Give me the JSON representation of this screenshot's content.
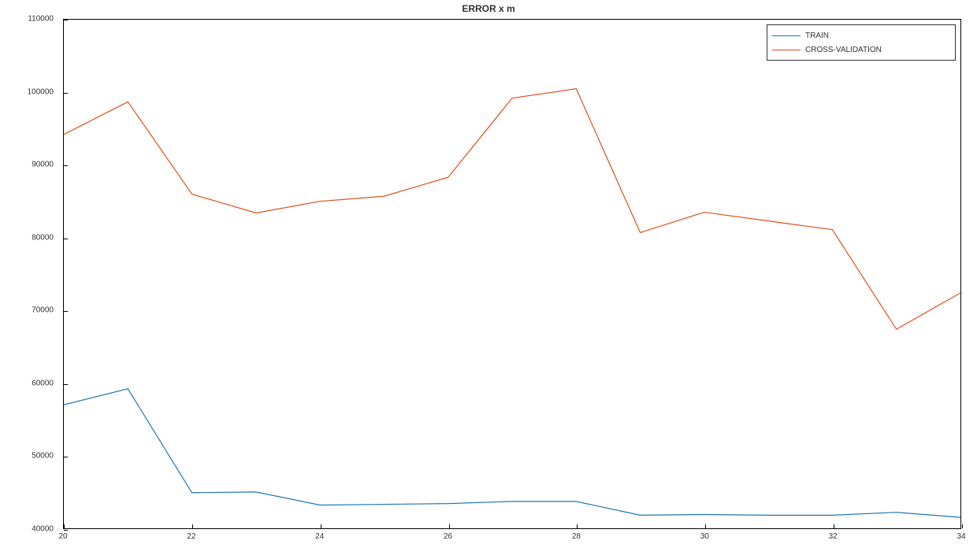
{
  "chart_data": {
    "type": "line",
    "title": "ERROR x m",
    "xlabel": "",
    "ylabel": "",
    "xlim": [
      20,
      34
    ],
    "ylim": [
      40000,
      110000
    ],
    "x_ticks": [
      20,
      22,
      24,
      26,
      28,
      30,
      32,
      34
    ],
    "y_ticks": [
      40000,
      50000,
      60000,
      70000,
      80000,
      90000,
      100000,
      110000
    ],
    "grid": false,
    "legend_position": "top-right",
    "x": [
      20,
      21,
      22,
      23,
      24,
      25,
      26,
      27,
      28,
      29,
      30,
      31,
      32,
      33,
      34
    ],
    "series": [
      {
        "name": "TRAIN",
        "color": "#1f77b4",
        "values": [
          57000,
          59200,
          44900,
          45000,
          43200,
          43300,
          43400,
          43700,
          43700,
          41800,
          41900,
          41800,
          41800,
          42200,
          41500
        ]
      },
      {
        "name": "CROSS-VALIDATION",
        "color": "#d95319",
        "values": [
          94200,
          98700,
          86000,
          83400,
          85000,
          85700,
          88300,
          99200,
          100500,
          80700,
          83500,
          82300,
          81100,
          67400,
          72400
        ]
      }
    ]
  }
}
